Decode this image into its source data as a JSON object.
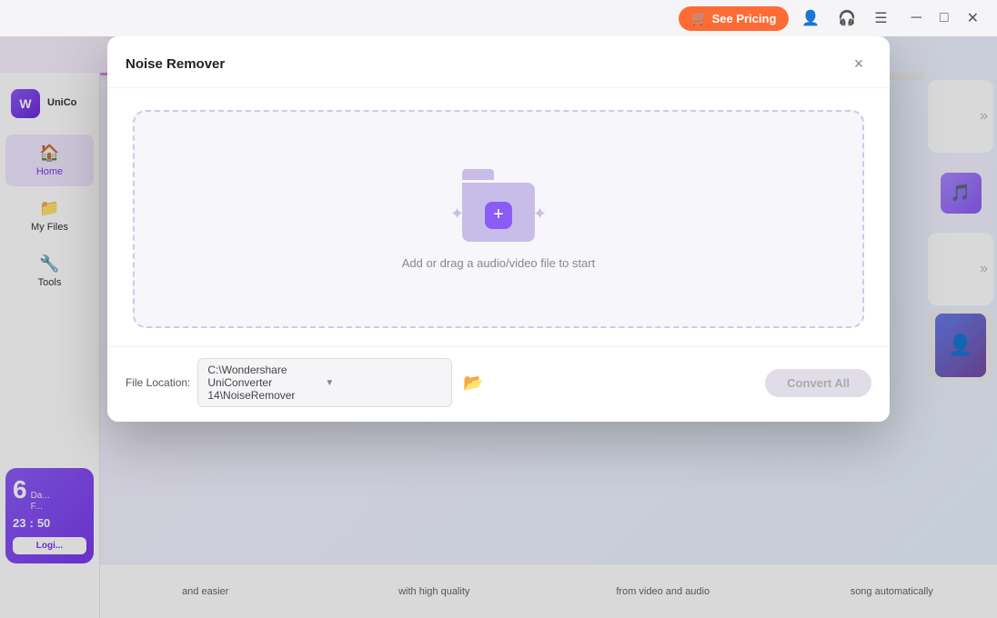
{
  "titleBar": {
    "seePricingLabel": "See Pricing",
    "minimizeTitle": "Minimize",
    "maximizeTitle": "Maximize",
    "closeTitle": "Close"
  },
  "sidebar": {
    "logoText": "UniCo",
    "items": [
      {
        "id": "home",
        "label": "Home",
        "icon": "🏠",
        "active": true
      },
      {
        "id": "myfiles",
        "label": "My Files",
        "icon": "📁",
        "active": false
      },
      {
        "id": "tools",
        "label": "Tools",
        "icon": "🔧",
        "active": false
      }
    ],
    "promo": {
      "number": "6",
      "dayLabel": "Da...",
      "extraLabel": "F...",
      "time1": "23",
      "colon": ":",
      "time2": "50",
      "loginLabel": "Logi..."
    }
  },
  "modal": {
    "title": "Noise Remover",
    "closeLabel": "×",
    "dropZone": {
      "text": "Add or drag a audio/video file to start"
    },
    "footer": {
      "fileLocationLabel": "File Location:",
      "filePath": "C:\\Wondershare UniConverter 14\\NoiseRemover",
      "convertAllLabel": "Convert All"
    }
  },
  "features": [
    {
      "text": "and easier"
    },
    {
      "text": "with high quality"
    },
    {
      "text": "from video and audio"
    },
    {
      "text": "song automatically"
    }
  ],
  "rightCards": [
    {
      "icon": "»",
      "type": "arrow"
    },
    {
      "icon": "🎵",
      "type": "music"
    },
    {
      "icon": "»",
      "type": "arrow"
    },
    {
      "icon": "👤",
      "type": "person"
    }
  ]
}
